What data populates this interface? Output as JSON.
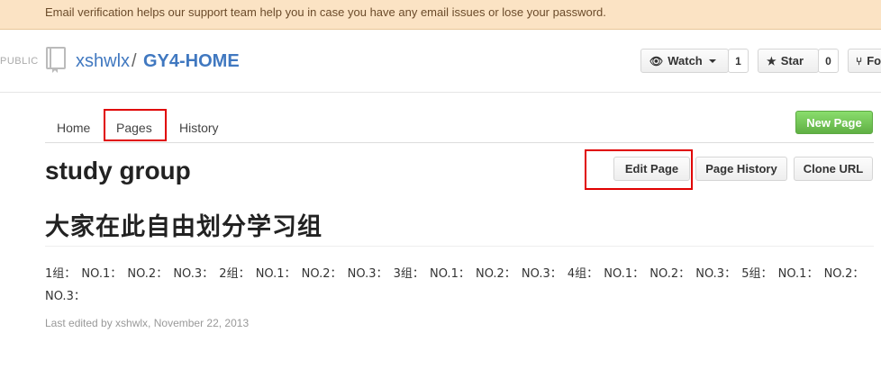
{
  "notice": {
    "text": "Email verification helps our support team help you in case you have any email issues or lose your password."
  },
  "repo": {
    "visibility": "PUBLIC",
    "owner": "xshwlx",
    "separator": "/",
    "name": "GY4-HOME"
  },
  "actions": {
    "watch_label": "Watch",
    "watch_count": "1",
    "star_label": "Star",
    "star_count": "0",
    "fork_label": "Fork"
  },
  "wiki_tabs": {
    "home": "Home",
    "pages": "Pages",
    "history": "History"
  },
  "new_page_label": "New Page",
  "page": {
    "title": "study group",
    "edit_label": "Edit Page",
    "history_label": "Page History",
    "clone_label": "Clone URL",
    "heading": "大家在此自由划分学习组",
    "body": "1组： NO.1： NO.2： NO.3： 2组： NO.1： NO.2： NO.3： 3组： NO.1： NO.2： NO.3： 4组： NO.1： NO.2： NO.3： 5组： NO.1： NO.2： NO.3：",
    "last_edited": "Last edited by xshwlx, November 22, 2013"
  },
  "colors": {
    "link": "#4078c0",
    "notice_bg": "#fbe3c4",
    "new_page_green": "#60b044",
    "highlight_red": "#e00000"
  }
}
